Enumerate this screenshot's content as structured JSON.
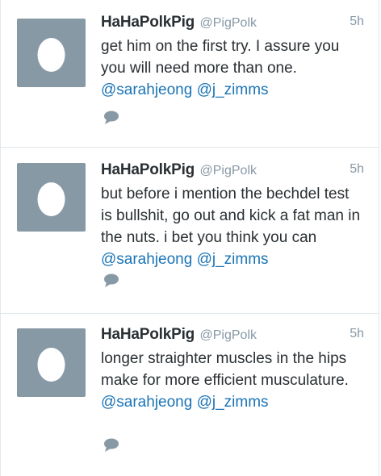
{
  "tweets": [
    {
      "author_name": "HaHaPolkPig",
      "handle": "@PigPolk",
      "time": "5h",
      "text": "get him on the first try. I assure you you will need more than one. ",
      "mentions": [
        "@sarahjeong",
        "@j_zimms"
      ],
      "avatar_icon": "egg-avatar-icon",
      "action_icon": "reply-icon"
    },
    {
      "author_name": "HaHaPolkPig",
      "handle": "@PigPolk",
      "time": "5h",
      "text": "but before i mention the bechdel test is bullshit, go out and kick a fat man in the nuts. i bet you think you can ",
      "mentions": [
        "@sarahjeong",
        "@j_zimms"
      ],
      "avatar_icon": "egg-avatar-icon",
      "action_icon": "reply-icon"
    },
    {
      "author_name": "HaHaPolkPig",
      "handle": "@PigPolk",
      "time": "5h",
      "text": "longer straighter muscles in the hips make for more efficient musculature. ",
      "mentions": [
        "@sarahjeong",
        "@j_zimms"
      ],
      "avatar_icon": "egg-avatar-icon",
      "action_icon": "reply-icon"
    }
  ],
  "colors": {
    "name": "#292f33",
    "meta": "#8899a6",
    "link": "#1b74b5",
    "avatar_bg": "#8899a6",
    "divider": "#e1e8ed"
  }
}
